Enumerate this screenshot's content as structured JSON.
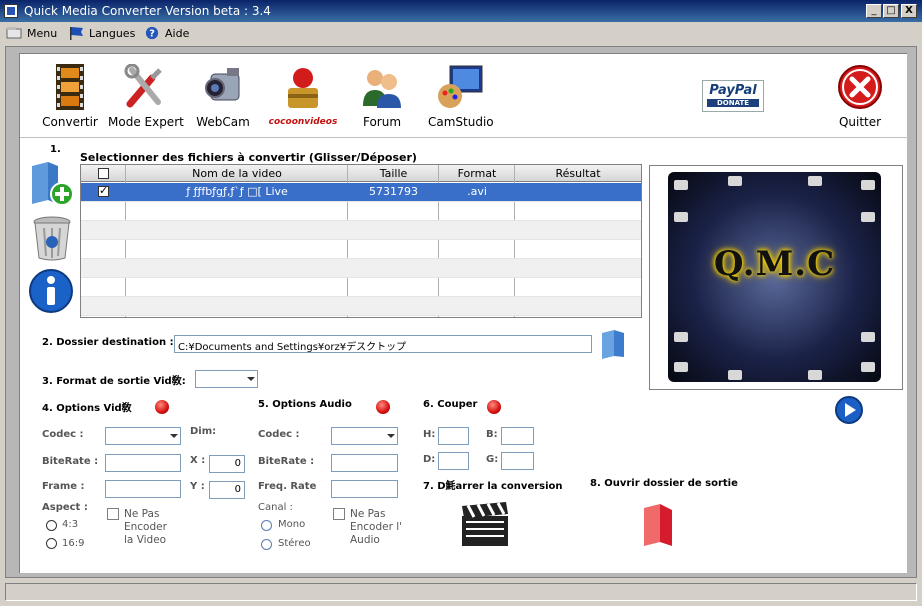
{
  "window": {
    "title": "Quick Media Converter   Version beta : 3.4",
    "min_label": "_",
    "max_label": "□",
    "close_label": "X"
  },
  "menu": {
    "items": [
      {
        "label": "Menu"
      },
      {
        "label": "Langues"
      },
      {
        "label": "Aide"
      }
    ]
  },
  "toolbar": {
    "items": [
      {
        "label": "Convertir"
      },
      {
        "label": "Mode Expert"
      },
      {
        "label": "WebCam"
      },
      {
        "label": "cocoonvideos"
      },
      {
        "label": "Forum"
      },
      {
        "label": "CamStudio"
      }
    ],
    "paypal_top": "PayPal",
    "paypal_bottom": "DONATE",
    "quit_label": "Quitter"
  },
  "step1": {
    "number": "1.",
    "heading": "Selectionner des fichiers à convertir (Glisser/Déposer)",
    "columns": [
      "Nom de la video",
      "Taille",
      "Format",
      "Résultat"
    ],
    "rows": [
      {
        "checked": true,
        "name": "ƒ ƒƒfbƒgƒ‚ƒ`ƒ  □[ Live",
        "size": "5731793",
        "format": ".avi",
        "result": ""
      }
    ]
  },
  "step2": {
    "label": "2. Dossier destination :",
    "path": "C:¥Documents and Settings¥orz¥デスクトップ"
  },
  "step3": {
    "label": "3. Format de sortie Vid敎:",
    "value": ""
  },
  "video": {
    "label": "4. Options Vid敎",
    "codec": "Codec :",
    "bitrate": "BiteRate :",
    "frame": "Frame  :",
    "aspect": "Aspect :",
    "dim": "Dim:",
    "x": "X :",
    "x_value": "0",
    "y": "Y :",
    "y_value": "0",
    "ratio_43": "4:3",
    "ratio_169": "16:9",
    "no_encode": [
      "Ne Pas",
      "Encoder",
      "la Video"
    ]
  },
  "audio": {
    "label": "5. Options Audio",
    "codec": "Codec :",
    "bitrate": "BiteRate :",
    "freq": "Freq. Rate",
    "canal": "Canal :",
    "mono": "Mono",
    "stereo": "Stéreo",
    "no_encode": [
      "Ne Pas",
      "Encoder l'",
      "Audio"
    ]
  },
  "cut": {
    "label": "6. Couper",
    "h": "H:",
    "b": "B:",
    "d": "D:",
    "g": "G:"
  },
  "step7": {
    "label": "7. D魹arrer la conversion"
  },
  "step8": {
    "label": "8. Ouvrir dossier de sortie"
  },
  "preview": {
    "logo_text": "Q.M.C"
  },
  "colors": {
    "titlebar": "#0a246a",
    "selection": "#3a6fc9",
    "panel": "#b7b7b7",
    "logo_glow": "#f5d000"
  }
}
